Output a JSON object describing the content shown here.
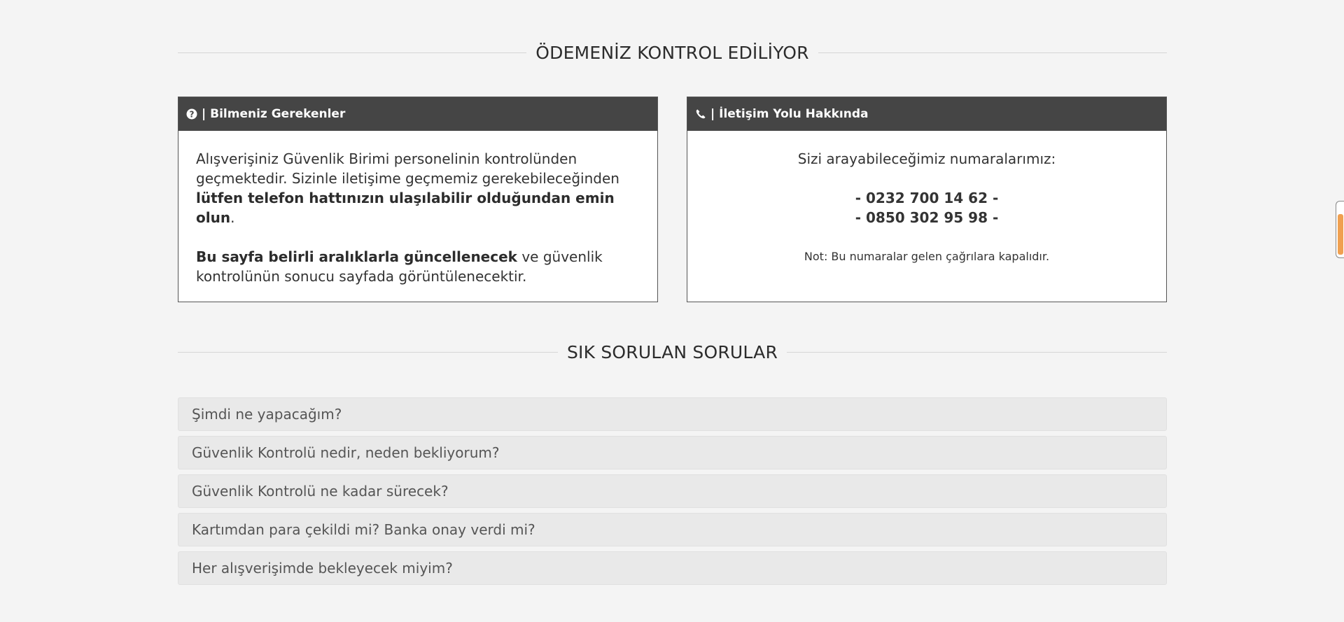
{
  "section1": {
    "title": "ÖDEMENİZ KONTROL EDİLİYOR"
  },
  "left_box": {
    "icon": "question-circle-icon",
    "header": "| Bilmeniz Gerekenler",
    "p1_plain": "Alışverişiniz Güvenlik Birimi personelinin kontrolünden geçmektedir. Sizinle iletişime geçmemiz gerekebileceğinden ",
    "p1_bold": "lütfen telefon hattınızın ulaşılabilir olduğundan emin olun",
    "p1_end": ".",
    "p2_bold": "Bu sayfa belirli aralıklarla güncellenecek",
    "p2_plain": " ve güvenlik kontrolünün sonucu sayfada görüntülenecektir."
  },
  "right_box": {
    "icon": "phone-icon",
    "header": "| İletişim Yolu Hakkında",
    "intro": "Sizi arayabileceğimiz numaralarımız:",
    "phones": [
      "- 0232 700 14 62 -",
      "- 0850 302 95 98 -"
    ],
    "note": "Not: Bu numaralar gelen çağrılara kapalıdır."
  },
  "section2": {
    "title": "SIK SORULAN SORULAR"
  },
  "faq": [
    "Şimdi ne yapacağım?",
    "Güvenlik Kontrolü nedir, neden bekliyorum?",
    "Güvenlik Kontrolü ne kadar sürecek?",
    "Kartımdan para çekildi mi? Banka onay verdi mi?",
    "Her alışverişimde bekleyecek miyim?"
  ],
  "colors": {
    "header_bg": "#454545",
    "page_bg": "#f4f4f4",
    "faq_bg": "#e9e9e9",
    "scroll_accent": "#f0a050"
  }
}
